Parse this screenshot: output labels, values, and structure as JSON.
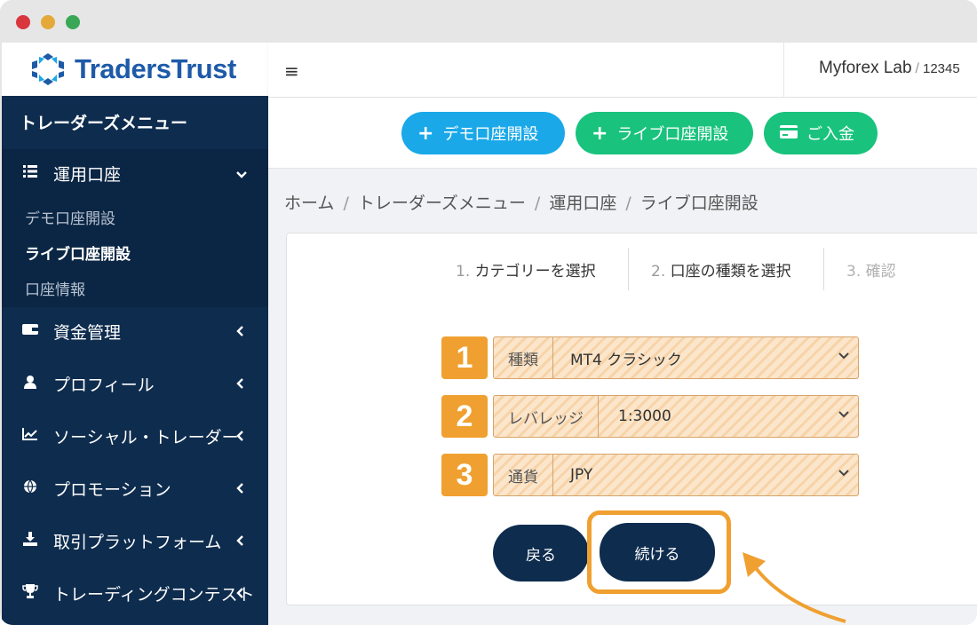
{
  "window": {
    "controls": [
      "close",
      "minimize",
      "maximize"
    ]
  },
  "header": {
    "logo_text": "TradersTrust",
    "menu_icon": "≡",
    "account_name": "Myforex Lab",
    "account_sep": "/",
    "account_number": "12345"
  },
  "sidebar": {
    "title": "トレーダーズメニュー",
    "open_menu": {
      "icon": "list-icon",
      "label": "運用口座",
      "chevron": "⌄"
    },
    "sub_items": [
      {
        "label": "デモ口座開設",
        "active": false
      },
      {
        "label": "ライブ口座開設",
        "active": true
      },
      {
        "label": "口座情報",
        "active": false
      }
    ],
    "items": [
      {
        "icon": "wallet-icon",
        "label": "資金管理"
      },
      {
        "icon": "user-icon",
        "label": "プロフィール"
      },
      {
        "icon": "chart-icon",
        "label": "ソーシャル・トレーダー"
      },
      {
        "icon": "globe-icon",
        "label": "プロモーション"
      },
      {
        "icon": "download-icon",
        "label": "取引プラットフォーム"
      },
      {
        "icon": "trophy-icon",
        "label": "トレーディングコンテスト"
      }
    ]
  },
  "actions": {
    "demo": "デモ口座開設",
    "live": "ライブ口座開設",
    "deposit": "ご入金"
  },
  "breadcrumb": [
    "ホーム",
    "トレーダーズメニュー",
    "運用口座",
    "ライブ口座開設"
  ],
  "steps": [
    {
      "num": "1.",
      "label": "カテゴリーを選択"
    },
    {
      "num": "2.",
      "label": "口座の種類を選択"
    },
    {
      "num": "3.",
      "label": "確認"
    }
  ],
  "form": {
    "fields": [
      {
        "badge": "1",
        "label": "種類",
        "value": "MT4 クラシック"
      },
      {
        "badge": "2",
        "label": "レバレッジ",
        "value": "1:3000"
      },
      {
        "badge": "3",
        "label": "通貨",
        "value": "JPY"
      }
    ],
    "back_label": "戻る",
    "continue_label": "続ける"
  },
  "colors": {
    "sidebar_bg": "#0e2c4e",
    "accent_orange": "#f0a030",
    "blue_button": "#1aa8e8",
    "green_button": "#19c37d"
  }
}
